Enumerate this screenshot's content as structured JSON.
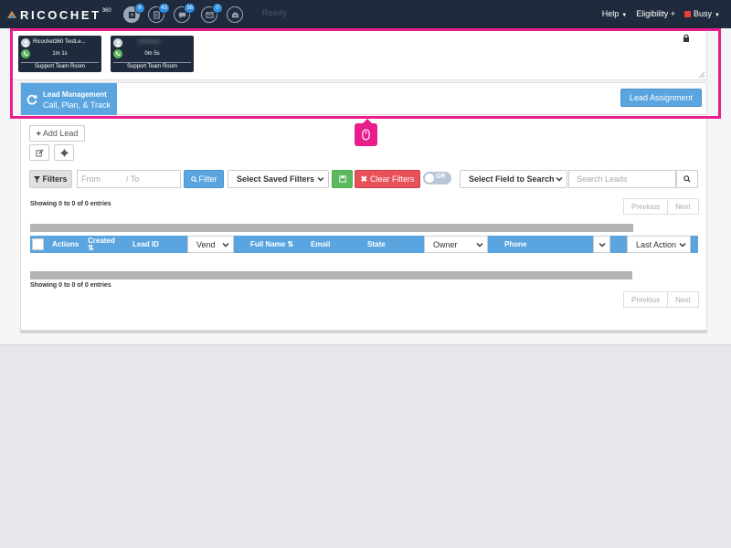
{
  "navbar": {
    "logo_text": "RICOCHET",
    "logo_sup": "360",
    "icons": [
      {
        "name": "leads-icon",
        "badge": "6"
      },
      {
        "name": "document-icon",
        "badge": "43"
      },
      {
        "name": "chat-icon",
        "badge": "56"
      },
      {
        "name": "mail-icon",
        "badge": "0"
      },
      {
        "name": "inbox-icon",
        "badge": ""
      }
    ],
    "status": "Ready",
    "help": "Help",
    "eligibility": "Eligibility",
    "eligibility_plus": "+",
    "busy": "Busy"
  },
  "calls": [
    {
      "name": "Ricochet360 TestLe...",
      "time": "1m 1s",
      "room": "Support Team Room"
    },
    {
      "name": "xxxxxxxx",
      "time": "0m 5s",
      "room": "Support Team Room"
    }
  ],
  "lead_management": {
    "title": "Lead Management",
    "subtitle": "Call, Plan, & Track",
    "assignment_button": "Lead Assignment"
  },
  "toolbar": {
    "add_lead": "Add Lead",
    "filters": "Filters",
    "from_placeholder": "From",
    "to_placeholder": "/  To",
    "filter_button": "Filter",
    "saved_filters": "Select Saved Filters",
    "clear_filters": "Clear Filters",
    "toggle_label": "Off",
    "search_field": "Select Field to Search",
    "search_placeholder": "Search Leads"
  },
  "table": {
    "info_top": "Showing 0 to 0 of 0 entries",
    "info_bottom": "Showing 0 to 0 of 0 entries",
    "previous": "Previous",
    "next": "Next",
    "columns": {
      "actions": "Actions",
      "created": "Created",
      "created_sort": "⇅",
      "lead_id": "Lead ID",
      "vendor": "Vend",
      "full_name": "Full Name ⇅",
      "email": "Email",
      "state": "State",
      "owner": "Owner",
      "phone": "Phone",
      "last_action": "Last Action"
    }
  },
  "colors": {
    "navbar": "#1f2b3c",
    "accent": "#5aa5e0",
    "highlight": "#e91e8c",
    "danger": "#e8515a",
    "success": "#5cb85c"
  }
}
